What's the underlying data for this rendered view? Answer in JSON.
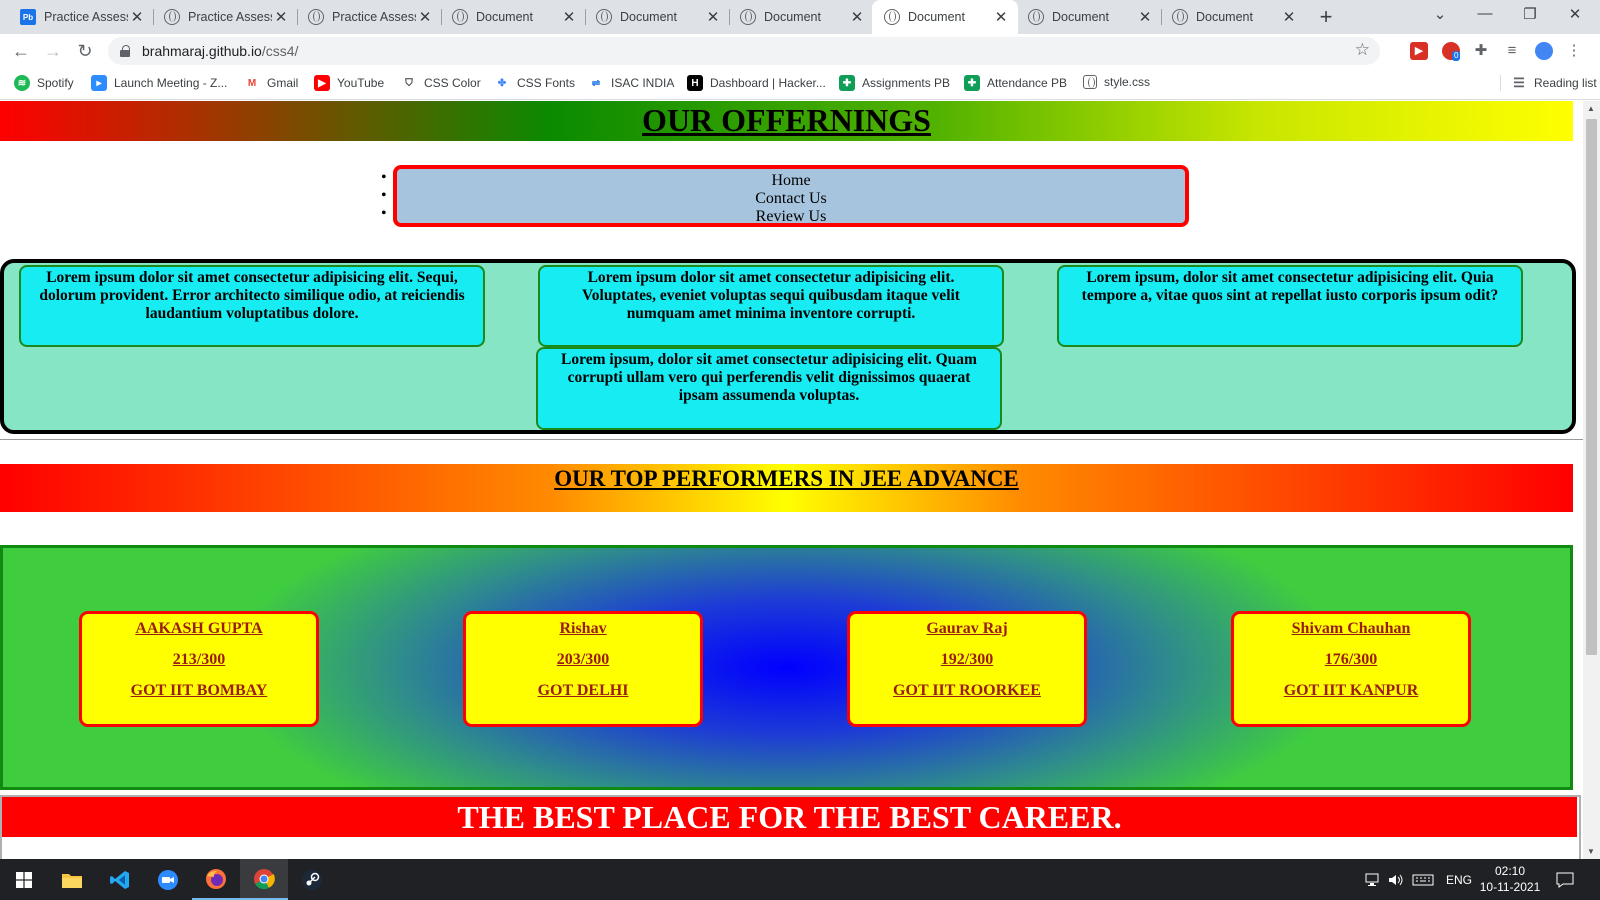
{
  "browser": {
    "tabs": [
      {
        "title": "Practice Assessm",
        "icon": "pb-icon"
      },
      {
        "title": "Practice Assessm",
        "icon": "globe-icon"
      },
      {
        "title": "Practice Assessm",
        "icon": "globe-icon"
      },
      {
        "title": "Document",
        "icon": "globe-icon"
      },
      {
        "title": "Document",
        "icon": "globe-icon"
      },
      {
        "title": "Document",
        "icon": "globe-icon"
      },
      {
        "title": "Document",
        "icon": "globe-icon",
        "active": true
      },
      {
        "title": "Document",
        "icon": "globe-icon"
      },
      {
        "title": "Document",
        "icon": "globe-icon"
      }
    ],
    "favicon_text": "Pb",
    "new_tab": "+",
    "url_host": "brahmaraj.github.io",
    "url_path": "/css4/",
    "bookmarks": [
      "Spotify",
      "Launch Meeting - Z...",
      "Gmail",
      "YouTube",
      "CSS Color",
      "CSS Fonts",
      "ISAC INDIA",
      "Dashboard | Hacker...",
      "Assignments PB",
      "Attendance PB",
      "style.css"
    ],
    "reading_list": "Reading list",
    "ext_badge": "0"
  },
  "page": {
    "offerings_title": "OUR OFFERNINGS",
    "nav_items": [
      "Home",
      "Contact Us",
      "Review Us"
    ],
    "lorem_boxes": [
      "Lorem ipsum dolor sit amet consectetur adipisicing elit. Sequi, dolorum provident. Error architecto similique odio, at reiciendis laudantium voluptatibus dolore.",
      "Lorem ipsum dolor sit amet consectetur adipisicing elit. Voluptates, eveniet voluptas sequi quibusdam itaque velit numquam amet minima inventore corrupti.",
      "Lorem ipsum, dolor sit amet consectetur adipisicing elit. Quia tempore a, vitae quos sint at repellat iusto corporis ipsum odit?",
      "Lorem ipsum, dolor sit amet consectetur adipisicing elit. Quam corrupti ullam vero qui perferendis velit dignissimos quaerat ipsam assumenda voluptas."
    ],
    "performers_title": "OUR TOP PERFORMERS IN JEE ADVANCE",
    "performers": [
      {
        "name": "AAKASH GUPTA",
        "score": "213/300",
        "result": "GOT IIT BOMBAY"
      },
      {
        "name": "Rishav",
        "score": "203/300",
        "result": "GOT DELHI"
      },
      {
        "name": "Gaurav Raj",
        "score": "192/300",
        "result": "GOT IIT ROORKEE"
      },
      {
        "name": "Shivam Chauhan",
        "score": "176/300",
        "result": "GOT IIT KANPUR"
      }
    ],
    "footer_text": "THE BEST PLACE FOR THE BEST CAREER."
  },
  "taskbar": {
    "apps": [
      "windows-start-icon",
      "file-explorer-icon",
      "vscode-icon",
      "zoom-icon",
      "firefox-icon",
      "chrome-icon",
      "steam-icon"
    ],
    "language": "ENG",
    "time": "02:10",
    "date": "10-11-2021"
  },
  "colors": {
    "page_nav_border": "#ff0000",
    "page_nav_bg": "#a6c4de",
    "lorem_bg": "#86e5c4",
    "lorem_box_bg": "#18ecf3",
    "card_bg": "#ffff00",
    "card_text": "#9a1c12",
    "footer_bg": "#ff0000"
  }
}
